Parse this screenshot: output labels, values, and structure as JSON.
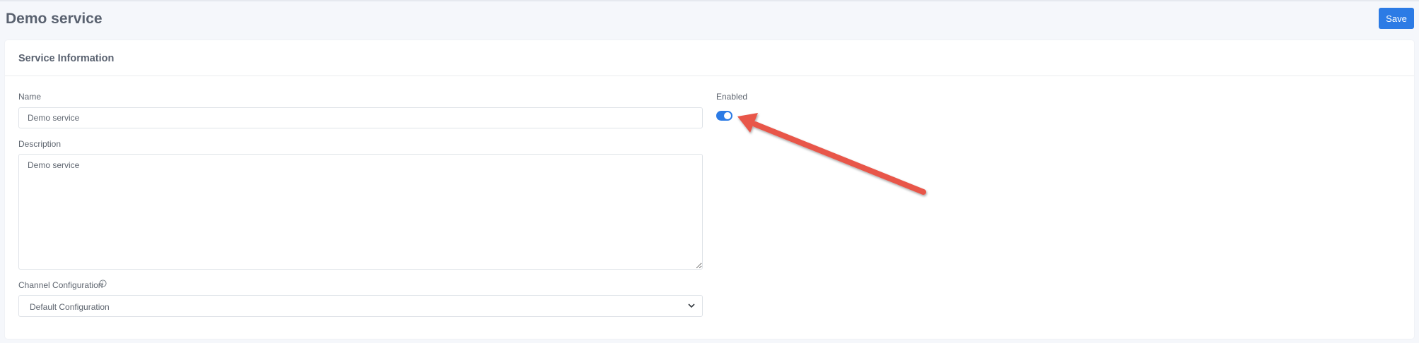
{
  "header": {
    "title": "Demo service",
    "save_label": "Save"
  },
  "card": {
    "title": "Service Information"
  },
  "form": {
    "name": {
      "label": "Name",
      "value": "Demo service"
    },
    "description": {
      "label": "Description",
      "value": "Demo service"
    },
    "channel_configuration": {
      "label": "Channel Configuration",
      "selected": "Default Configuration"
    },
    "enabled": {
      "label": "Enabled",
      "on": true
    }
  },
  "icons": {
    "info": "info-icon",
    "chevron": "chevron-down-icon",
    "annotation": "red-arrow-icon"
  },
  "colors": {
    "primary": "#2c7be5",
    "arrow": "#e8574a"
  }
}
